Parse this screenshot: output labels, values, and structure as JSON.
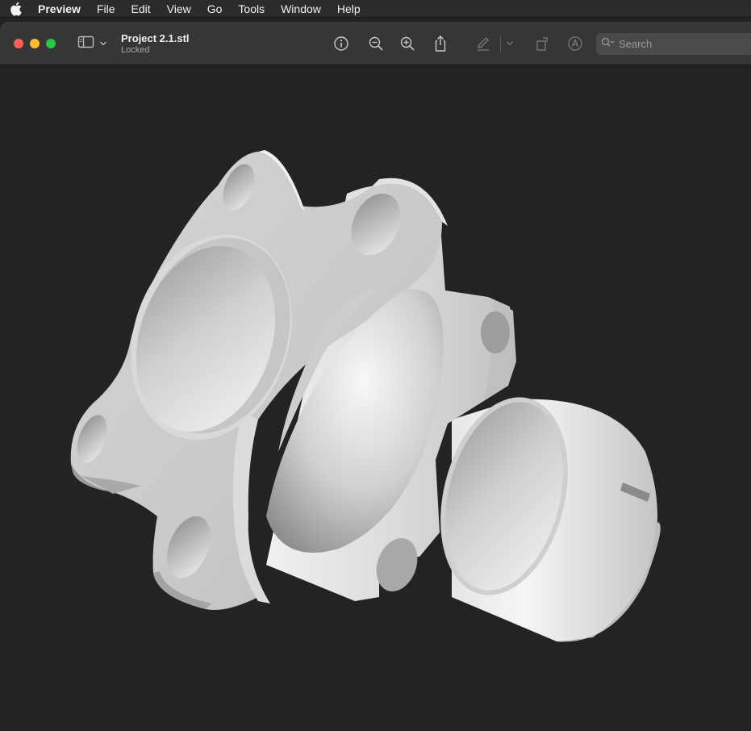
{
  "menubar": {
    "app_name": "Preview",
    "items": [
      "File",
      "Edit",
      "View",
      "Go",
      "Tools",
      "Window",
      "Help"
    ]
  },
  "window": {
    "title": "Project 2.1.stl",
    "subtitle": "Locked"
  },
  "toolbar": {
    "icons": [
      "sidebar-icon",
      "info-icon",
      "zoom-out-icon",
      "zoom-in-icon",
      "share-icon",
      "markup-pen-icon",
      "rotate-icon",
      "markup-circle-icon"
    ],
    "search_placeholder": "Search"
  },
  "viewer": {
    "content": "3D model render of flanged hub part",
    "model_color": "#d9d9d9",
    "background": "#232323"
  }
}
